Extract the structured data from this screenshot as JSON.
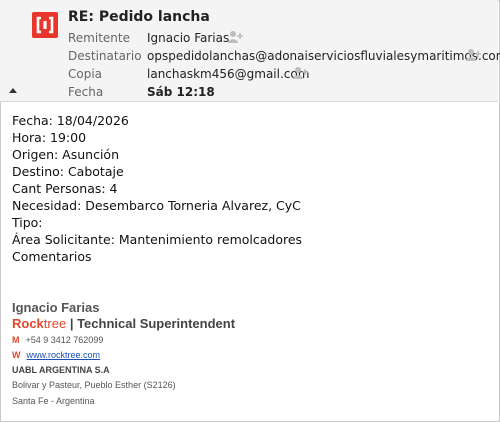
{
  "header": {
    "subject": "RE: Pedido lancha",
    "fields": [
      {
        "label": "Remitente",
        "value": "Ignacio Farias"
      },
      {
        "label": "Destinatario",
        "value": "opspedidolanchas@adonaiserviciosfluvialesymaritimos.com"
      },
      {
        "label": "Copia",
        "value": "lanchaskm456@gmail.com"
      },
      {
        "label": "Fecha",
        "value": "Sáb 12:18"
      }
    ]
  },
  "body": {
    "lines": [
      "Fecha: 18/04/2026",
      "Hora: 19:00",
      "Origen: Asunción",
      "Destino: Cabotaje",
      "Cant Personas: 4",
      "Necesidad: Desembarco Torneria Alvarez, CyC",
      "Tipo:",
      "Área Solicitante: Mantenimiento remolcadores",
      "Comentarios"
    ]
  },
  "signature": {
    "name": "Ignacio Farias",
    "brand_rock": "Rock",
    "brand_tree": "tree",
    "separator": " | ",
    "title": "Technical Superintendent",
    "mobile_key": "M",
    "mobile": "+54 9 3412 762099",
    "web_key": "W",
    "web": "www.rocktree.com",
    "company": "UABL ARGENTINA S.A",
    "address1": "Bolivar y Pasteur, Pueblo Esther (S2126)",
    "address2": "Santa Fe - Argentina"
  },
  "colors": {
    "accent": "#e0492b",
    "logo": "#e8362d",
    "link": "#1a4fb8"
  },
  "icons": {
    "add_contact": "add-contact-icon",
    "logo": "app-logo-icon",
    "collapse": "collapse-triangle-icon"
  }
}
